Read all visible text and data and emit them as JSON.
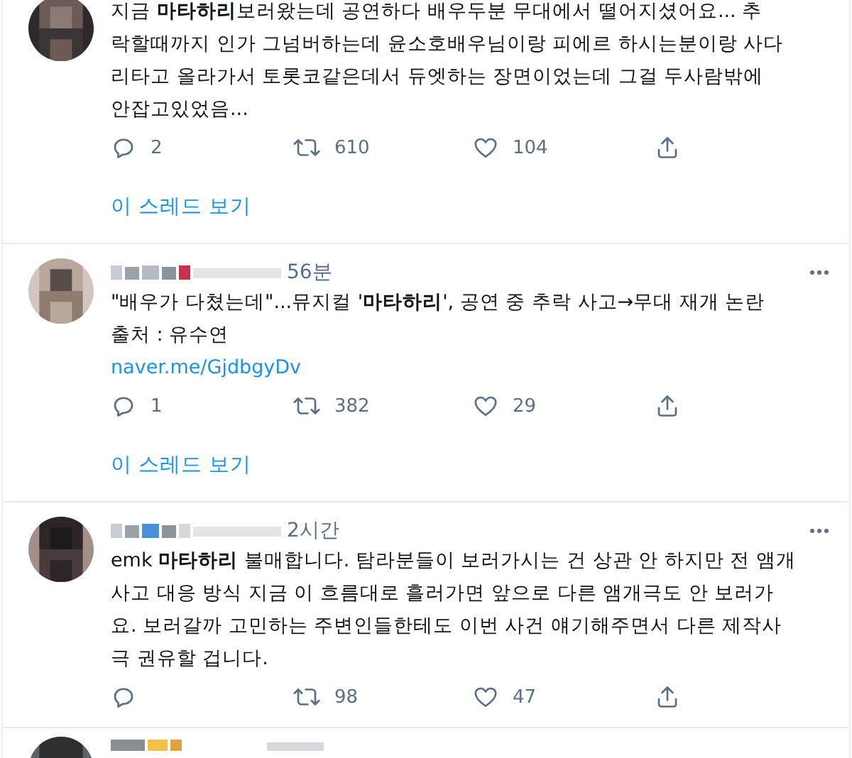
{
  "tweets": [
    {
      "lines": [
        "지금 **마타하리**보러왔는데 공연하다 배우두분 무대에서 떨어지셨어요...   추",
        "락할때까지 인가 그넘버하는데 윤소호배우님이랑 피에르 하시는분이랑 사다",
        "리타고 올라가서 토롯코같은데서 듀엣하는 장면이었는데 그걸 두사람밖에",
        "안잡고있었음..."
      ],
      "stats": {
        "replies": "2",
        "retweets": "610",
        "likes": "104"
      },
      "thread_link": "이 스레드 보기"
    },
    {
      "time": "56분",
      "lines": [
        "\"배우가 다쳤는데\"...뮤지컬 '**마타하리**', 공연 중 추락 사고→무대 재개 논란",
        "출처 : 유수연"
      ],
      "link": "naver.me/GjdbgyDv",
      "stats": {
        "replies": "1",
        "retweets": "382",
        "likes": "29"
      },
      "thread_link": "이 스레드 보기"
    },
    {
      "time": "2시간",
      "lines": [
        "emk **마타하리** 불매합니다. 탐라분들이 보러가시는 건 상관 안 하지만 전 앰개",
        "사고 대응 방식 지금 이 흐름대로 흘러가면 앞으로 다른 앰개극도 안 보러가",
        "요. 보러갈까 고민하는 주변인들한테도 이번 사건 얘기해주면서 다른 제작사",
        "극 권유할 겁니다."
      ],
      "stats": {
        "retweets": "98",
        "likes": "47"
      }
    }
  ]
}
